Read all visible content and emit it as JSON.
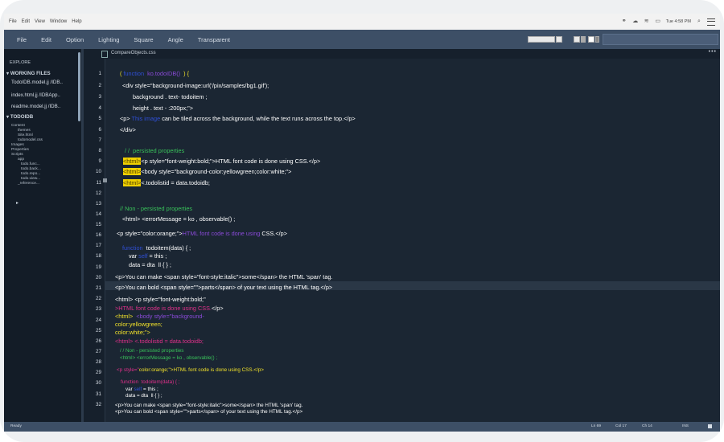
{
  "menubar": {
    "items": [
      "File",
      "Edit",
      "View",
      "Window",
      "Help"
    ],
    "clock": "Tue 4:58 PM"
  },
  "toolbar": {
    "items": [
      "File",
      "Edit",
      "Option",
      "Lighting",
      "Square",
      "Angle",
      "Transparent"
    ]
  },
  "sidebar": {
    "explore": "EXPLORE",
    "working_files": "WORKING FILES",
    "files": [
      "TodoIDB.model.jj  /IDB..",
      "index.html.jj  /IDBApp..",
      "readme.model.jj  /IDB.."
    ],
    "project": "TODOIDB",
    "tree": [
      "Content",
      "themes",
      "Site.html",
      "todomodel.css",
      "Images",
      "Properties",
      "Scripts",
      "app",
      "todo.func...",
      "todo.back...",
      "todo.repo...",
      "todo.view...",
      "_reference..."
    ],
    "arrow": "▸"
  },
  "editor": {
    "tab": "CompareObjects.css",
    "tab_menu": "•••",
    "lines": {
      "1": [
        "( ",
        "function",
        "  ",
        "ko.todoIDB()",
        "  ) {"
      ],
      "2": "<div style=\"background-image:url('/pix/samples/bg1.gif');",
      "3": "background . text- todoitem ;",
      "4": "height . text - :200px;\">",
      "5a": "<p> ",
      "5b": "This image",
      "5c": " can be tiled across the background, while the text runs across the top.</p>",
      "6": "</div>",
      "8": "/ /  persisted properties",
      "9a": "<html>",
      "9b": "<p style=\"font-weight:bold;\">HTML font code is done using CSS.</p>",
      "10a": "<html>",
      "10b": "<body style=\"background-color:yellowgreen;color:white;\">",
      "11a": "<html>",
      "11b": "<.todolistid = data.todoidb;",
      "14a": "// Non - persisted properties",
      "14b": "<html> <errorMessage = ko , observable() ;",
      "16a": "<p style=\"color:orange;\">",
      "16b": "HTML font code is done using",
      "16c": " CSS.</p>",
      "18a": "function",
      "18b": "  todoitem(data) { ;",
      "19a": "var ",
      "19b": "self",
      "19c": " = this ;",
      "20": "data = dta  ll { } ;",
      "22": "<p>You can make <span style=\"font-style:italic\">some</span> the HTML 'span' tag.",
      "23": "<p>You can bold <span style=\"\">parts</span> of your text using the HTML tag.</p>",
      "25": "<html> <p style=\"font-weight:bold;\"",
      "26a": ">",
      "26b": "HTML font code is done using CSS.",
      "26c": "</p>",
      "27a": "<html>",
      "27b": "  <body style=\"background-",
      "28": "color:yellowgreen;",
      "29": "color:white;\">",
      "30": "<html> <.todolistid = data.todoidb;",
      "31": "/ / Non - persisted properties",
      "32": "<html> <errorMessage = ko , observable() ;",
      "33a": "<p style=\"",
      "33b": "color:orange;\">HTML font code is done using CSS.</p>",
      "34a": "function",
      "34b": "  todoitem(data) { ;",
      "35a": "var ",
      "35b": "self",
      "35c": " = this ;",
      "36": "data = dta  ll { } ;",
      "37": "<p>You can make <span style=\"font-style:italic\">some</span> the HTML 'span' tag.",
      "38": "<p>You can bold <span style=\"\">parts</span> of your text using the HTML tag.</p>"
    }
  },
  "status": {
    "ready": "Ready",
    "ln": "Ln 69",
    "col": "Col 17",
    "ch": "Ch 14",
    "mode": "INS"
  }
}
